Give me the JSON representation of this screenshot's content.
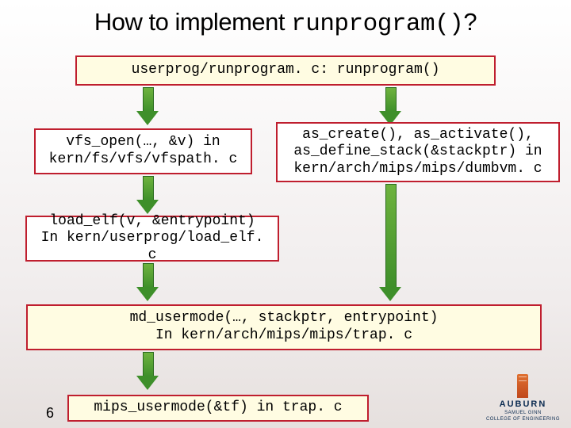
{
  "title_left": "How to implement ",
  "title_code": "runprogram()",
  "title_right": "?",
  "boxes": {
    "top": "userprog/runprogram. c: runprogram()",
    "vfs": "vfs_open(…, &v) in\nkern/fs/vfs/vfspath. c",
    "as": "as_create(), as_activate(),\nas_define_stack(&stackptr) in\nkern/arch/mips/mips/dumbvm. c",
    "loadelf": "load_elf(v, &entrypoint)\nIn kern/userprog/load_elf. c",
    "md": "md_usermode(…, stackptr, entrypoint)\nIn kern/arch/mips/mips/trap. c",
    "mips": "mips_usermode(&tf) in trap. c"
  },
  "slidenum": "6",
  "logo": {
    "name": "AUBURN",
    "sub1": "SAMUEL GINN",
    "sub2": "COLLEGE OF ENGINEERING"
  }
}
